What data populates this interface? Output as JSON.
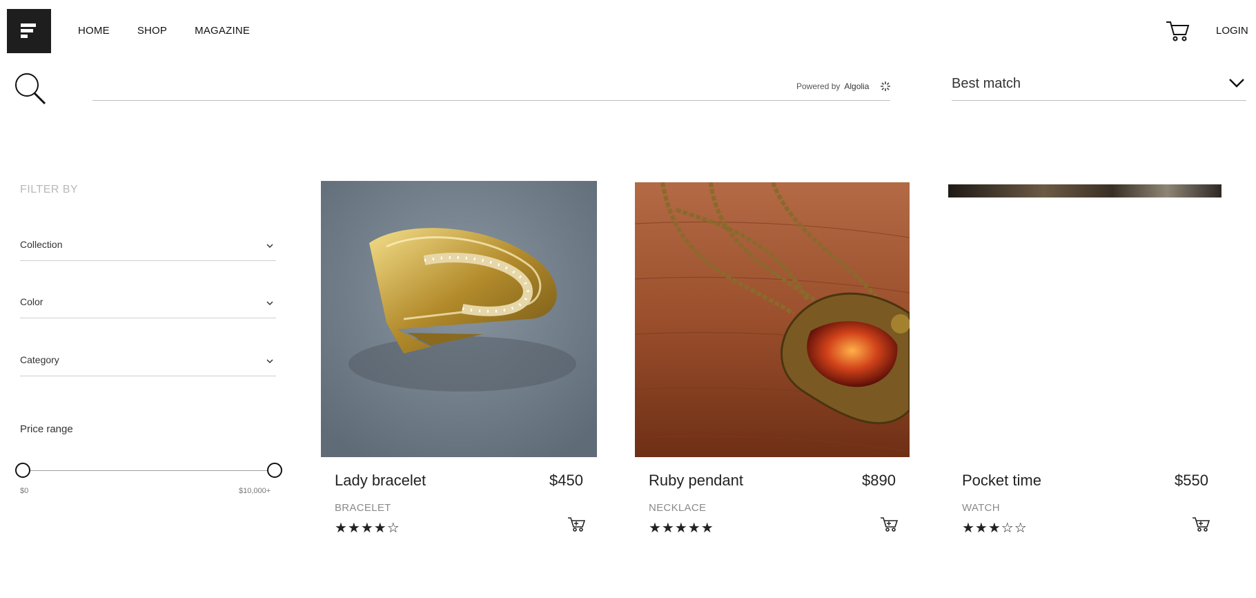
{
  "header": {
    "menu_icon": "menu-icon",
    "nav": [
      "HOME",
      "SHOP",
      "MAGAZINE"
    ],
    "cart_icon": "shopping-cart-icon",
    "login": "LOGIN"
  },
  "search": {
    "icon": "search-icon",
    "value": "",
    "placeholder": "",
    "powered_prefix": "Powered by",
    "powered_brand": "Algolia"
  },
  "sort": {
    "selected": "Best match",
    "icon": "chevron-down-icon"
  },
  "filters": {
    "title": "FILTER BY",
    "items": [
      "Collection",
      "Color",
      "Category"
    ],
    "price": {
      "title": "Price range",
      "min_label": "$0",
      "max_label": "$10,000+"
    }
  },
  "products": [
    {
      "name": "Lady bracelet",
      "price": "$450",
      "category": "BRACELET",
      "stars": "★★★★☆",
      "rating": 4
    },
    {
      "name": "Ruby pendant",
      "price": "$890",
      "category": "NECKLACE",
      "stars": "★★★★★",
      "rating": 5
    },
    {
      "name": "Pocket time",
      "price": "$550",
      "category": "WATCH",
      "stars": "★★★☆☆",
      "rating": 3
    }
  ],
  "colors": {
    "menu_bg": "#1e1e1e",
    "text": "#222222",
    "muted": "#8a8a8a"
  }
}
